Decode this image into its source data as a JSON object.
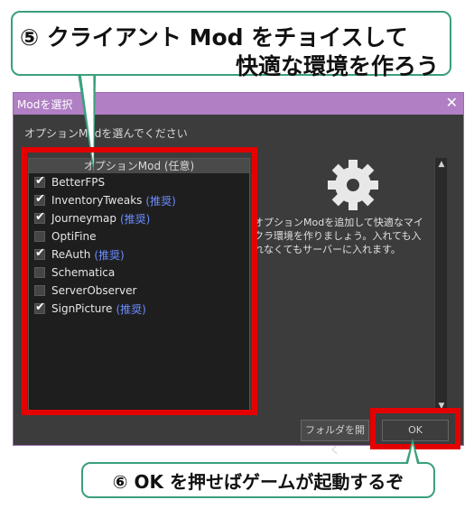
{
  "callout_top": {
    "line1": "⑤ クライアント Mod をチョイスして",
    "line2": "快適な環境を作ろう"
  },
  "window": {
    "title": "Modを選択",
    "close": "✕",
    "subtitle": "オプションModを選んでください"
  },
  "list": {
    "header": "オプションMod (任意)",
    "items": [
      {
        "label": "BetterFPS",
        "checked": true,
        "tag": ""
      },
      {
        "label": "InventoryTweaks",
        "checked": true,
        "tag": "(推奨)"
      },
      {
        "label": "Journeymap",
        "checked": true,
        "tag": "(推奨)"
      },
      {
        "label": "OptiFine",
        "checked": false,
        "tag": ""
      },
      {
        "label": "ReAuth",
        "checked": true,
        "tag": "(推奨)"
      },
      {
        "label": "Schematica",
        "checked": false,
        "tag": ""
      },
      {
        "label": "ServerObserver",
        "checked": false,
        "tag": ""
      },
      {
        "label": "SignPicture",
        "checked": true,
        "tag": "(推奨)"
      }
    ]
  },
  "info": {
    "icon": "gear-icon",
    "text": "オプションModを追加して快適なマイクラ環境を作りましょう。入れても入れなくてもサーバーに入れます。"
  },
  "scroll": {
    "up": "▲",
    "down": "▼"
  },
  "buttons": {
    "folder": "フォルダを開く",
    "ok": "OK"
  },
  "callout_bottom": {
    "text": "⑥ OK を押せばゲームが起動するぞ"
  },
  "colors": {
    "accent": "#b07fc4",
    "highlight": "#e50000",
    "callout_border": "#3aa07a",
    "recommended": "#6b8cff"
  }
}
